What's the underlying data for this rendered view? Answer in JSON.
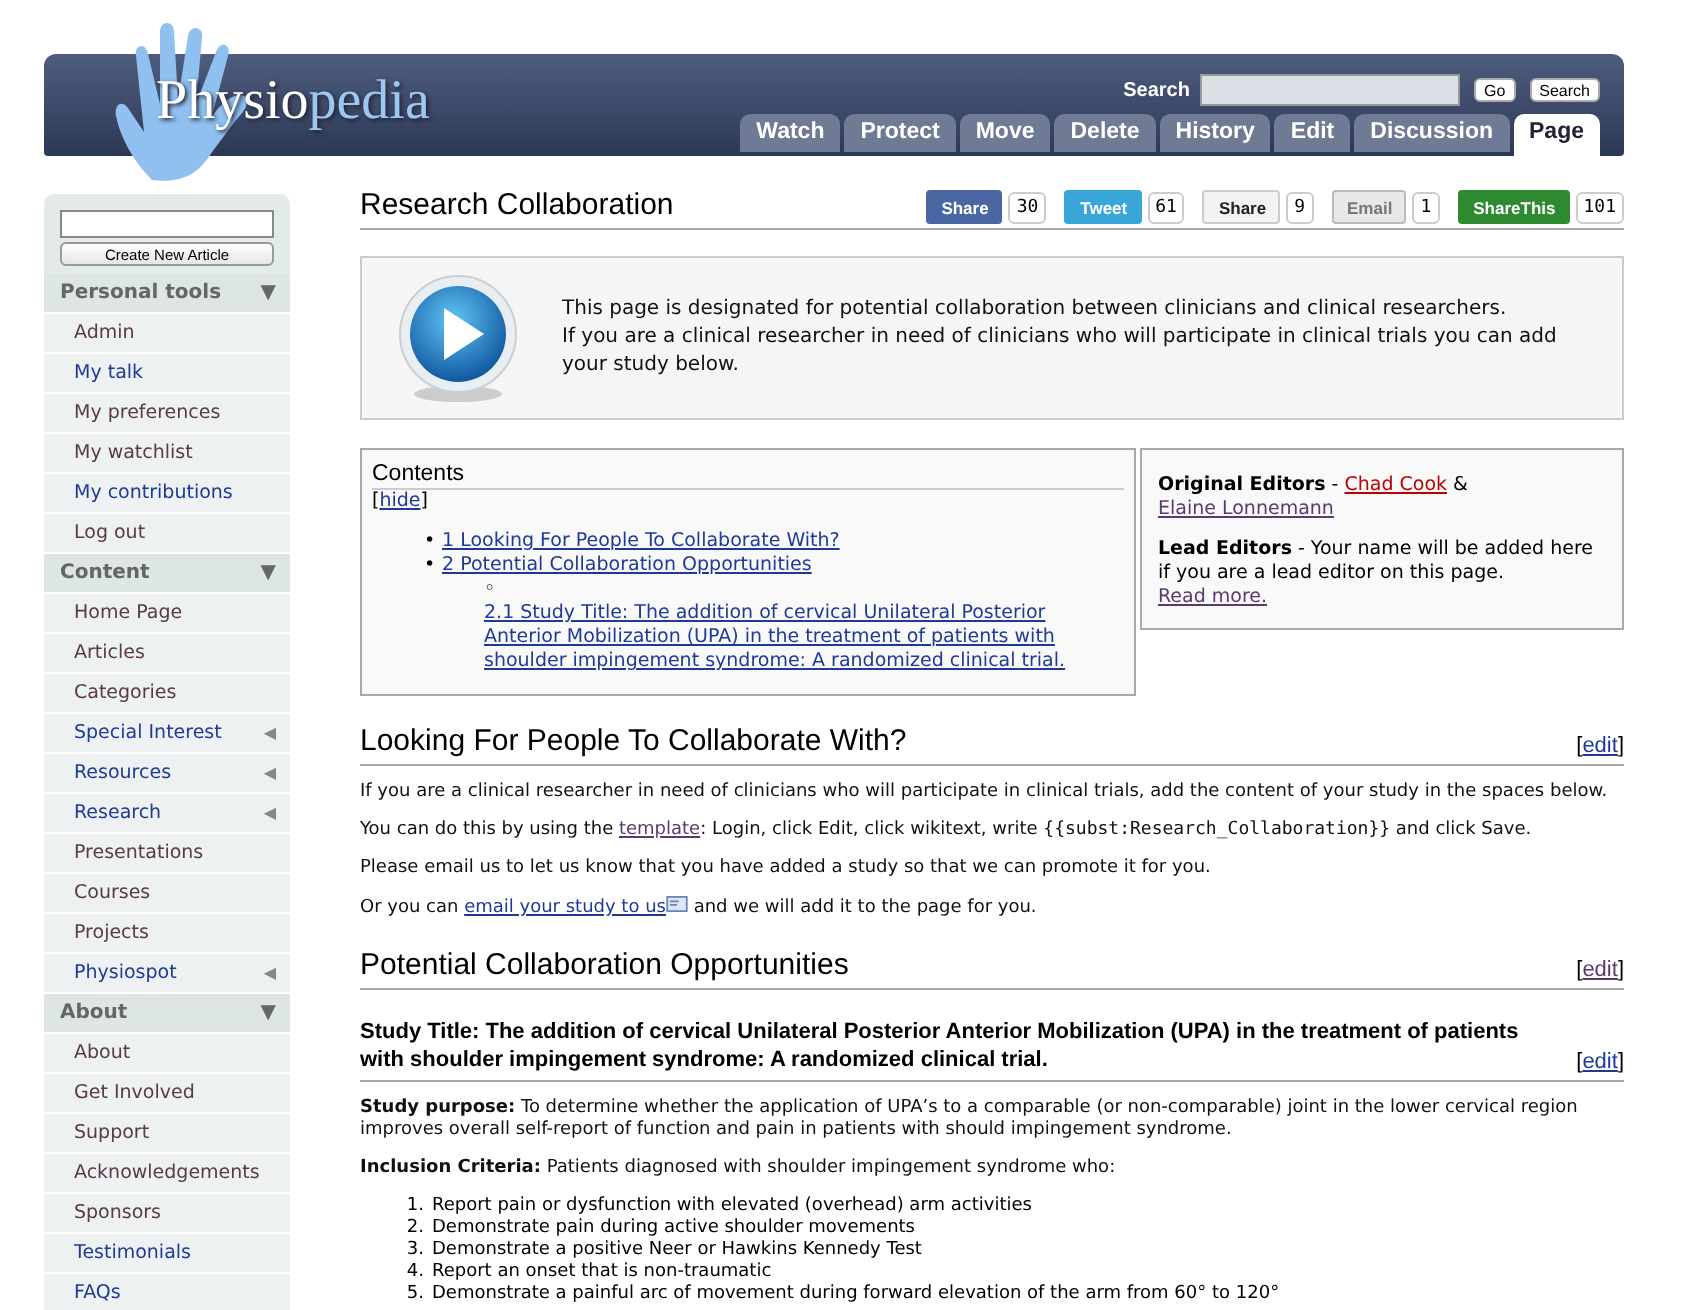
{
  "header": {
    "logo": {
      "first": "Physio",
      "second": "pedia"
    },
    "search": {
      "label": "Search",
      "go": "Go",
      "button": "Search"
    },
    "tabs": [
      {
        "label": "Watch",
        "selected": false
      },
      {
        "label": "Protect",
        "selected": false
      },
      {
        "label": "Move",
        "selected": false
      },
      {
        "label": "Delete",
        "selected": false
      },
      {
        "label": "History",
        "selected": false
      },
      {
        "label": "Edit",
        "selected": false
      },
      {
        "label": "Discussion",
        "selected": false
      },
      {
        "label": "Page",
        "selected": true
      }
    ]
  },
  "sidebar": {
    "create_button": "Create New Article",
    "sections": [
      {
        "title": "Personal tools",
        "arrow": "▼",
        "items": [
          {
            "label": "Admin",
            "visited": true
          },
          {
            "label": "My talk",
            "visited": false
          },
          {
            "label": "My preferences",
            "visited": true
          },
          {
            "label": "My watchlist",
            "visited": true
          },
          {
            "label": "My contributions",
            "visited": false
          },
          {
            "label": "Log out",
            "visited": true
          }
        ]
      },
      {
        "title": "Content",
        "arrow": "▼",
        "items": [
          {
            "label": "Home Page",
            "visited": true
          },
          {
            "label": "Articles",
            "visited": true
          },
          {
            "label": "Categories",
            "visited": true
          },
          {
            "label": "Special Interest",
            "visited": false,
            "arrow": "◀"
          },
          {
            "label": "Resources",
            "visited": false,
            "arrow": "◀"
          },
          {
            "label": "Research",
            "visited": false,
            "arrow": "◀"
          },
          {
            "label": "Presentations",
            "visited": true
          },
          {
            "label": "Courses",
            "visited": true
          },
          {
            "label": "Projects",
            "visited": true
          },
          {
            "label": "Physiospot",
            "visited": false,
            "arrow": "◀"
          }
        ]
      },
      {
        "title": "About",
        "arrow": "▼",
        "items": [
          {
            "label": "About",
            "visited": true
          },
          {
            "label": "Get Involved",
            "visited": true
          },
          {
            "label": "Support",
            "visited": true
          },
          {
            "label": "Acknowledgements",
            "visited": true
          },
          {
            "label": "Sponsors",
            "visited": true
          },
          {
            "label": "Testimonials",
            "visited": false
          },
          {
            "label": "FAQs",
            "visited": false
          }
        ]
      }
    ]
  },
  "page": {
    "title": "Research Collaboration",
    "share_buttons": [
      {
        "kind": "facebook",
        "label": "Share",
        "count": "30"
      },
      {
        "kind": "twitter",
        "label": "Tweet",
        "count": "61"
      },
      {
        "kind": "linkedin",
        "label": "Share",
        "count": "9"
      },
      {
        "kind": "email",
        "label": "Email",
        "count": "1"
      },
      {
        "kind": "sharethis",
        "label": "ShareThis",
        "count": "101"
      }
    ],
    "notice": [
      "This page is designated for potential collaboration between clinicians and clinical researchers.",
      "If you are a clinical researcher in need of clinicians who will participate in clinical trials you can add your study below."
    ],
    "contents": {
      "title": "Contents",
      "hide": {
        "open": "[",
        "link": "hide",
        "close": "]"
      },
      "items": [
        {
          "marker": "•",
          "label": "1 Looking For People To Collaborate With?"
        },
        {
          "marker": "•",
          "label": "2 Potential Collaboration Opportunities",
          "children": [
            {
              "marker": "◦",
              "label": "2.1 Study Title: The addition of cervical Unilateral Posterior Anterior Mobilization (UPA) in the treatment of patients with shoulder impingement syndrome: A randomized clinical trial."
            }
          ]
        }
      ]
    },
    "editors": [
      [
        {
          "kind": "bold",
          "text": "Original Editors"
        },
        {
          "kind": "text",
          "text": " - "
        },
        {
          "kind": "redlink",
          "text": "Chad Cook"
        },
        {
          "kind": "text",
          "text": " & "
        },
        {
          "kind": "visited",
          "text": "Elaine Lonnemann"
        }
      ],
      [
        {
          "kind": "bold",
          "text": "Lead Editors"
        },
        {
          "kind": "text",
          "text": " - Your name will be added here if you are a lead editor on this page.  "
        },
        {
          "kind": "visited",
          "text": "Read more."
        }
      ]
    ],
    "sections": [
      {
        "kind": "heading",
        "title": "Looking For People To Collaborate With?",
        "edit": {
          "open": "[",
          "link": "edit",
          "close": "]",
          "visited": false
        },
        "paragraphs": [
          [
            {
              "kind": "text",
              "text": "If you are a clinical researcher in need of clinicians who will participate in clinical trials, add the content of your study in the spaces below."
            }
          ],
          [
            {
              "kind": "text",
              "text": "You can do this by using the "
            },
            {
              "kind": "visited",
              "text": "template"
            },
            {
              "kind": "text",
              "text": ": Login, click Edit, click wikitext, write "
            },
            {
              "kind": "code",
              "text": "{{subst:Research_Collaboration}}"
            },
            {
              "kind": "text",
              "text": " and click Save."
            }
          ],
          [
            {
              "kind": "text",
              "text": "Please email us to let us know that you have added a study so that we can promote it for you."
            }
          ],
          [
            {
              "kind": "text",
              "text": "Or you can "
            },
            {
              "kind": "mail",
              "text": "email your study to us"
            },
            {
              "kind": "text",
              "text": " and we will add it to the page for you."
            }
          ]
        ]
      },
      {
        "kind": "heading",
        "title": "Potential Collaboration Opportunities",
        "edit": {
          "open": "[",
          "link": "edit",
          "close": "]",
          "visited": true
        }
      },
      {
        "kind": "subheading",
        "title": "Study Title: The addition of cervical Unilateral Posterior Anterior Mobilization (UPA) in the treatment of patients with shoulder impingement syndrome: A randomized clinical trial.",
        "edit": {
          "open": "[",
          "link": "edit",
          "close": "]",
          "visited": false
        },
        "paragraphs": [
          [
            {
              "kind": "bold",
              "text": "Study purpose:"
            },
            {
              "kind": "text",
              "text": " To determine whether the application of UPA’s to a comparable (or non-comparable) joint in the lower cervical region improves overall self-report of function and pain in patients with should impingement syndrome."
            }
          ],
          [
            {
              "kind": "bold",
              "text": "Inclusion Criteria:"
            },
            {
              "kind": "text",
              "text": " Patients diagnosed with shoulder impingement syndrome who:"
            }
          ]
        ],
        "list": [
          {
            "number": "1.",
            "text": "Report pain or dysfunction with elevated (overhead) arm activities"
          },
          {
            "number": "2.",
            "text": "Demonstrate pain during active shoulder movements"
          },
          {
            "number": "3.",
            "text": "Demonstrate a positive Neer or Hawkins Kennedy Test"
          },
          {
            "number": "4.",
            "text": "Report an onset that is non-traumatic"
          },
          {
            "number": "5.",
            "text": "Demonstrate a painful arc of movement during forward elevation of the arm from 60° to 120°"
          }
        ]
      }
    ]
  }
}
